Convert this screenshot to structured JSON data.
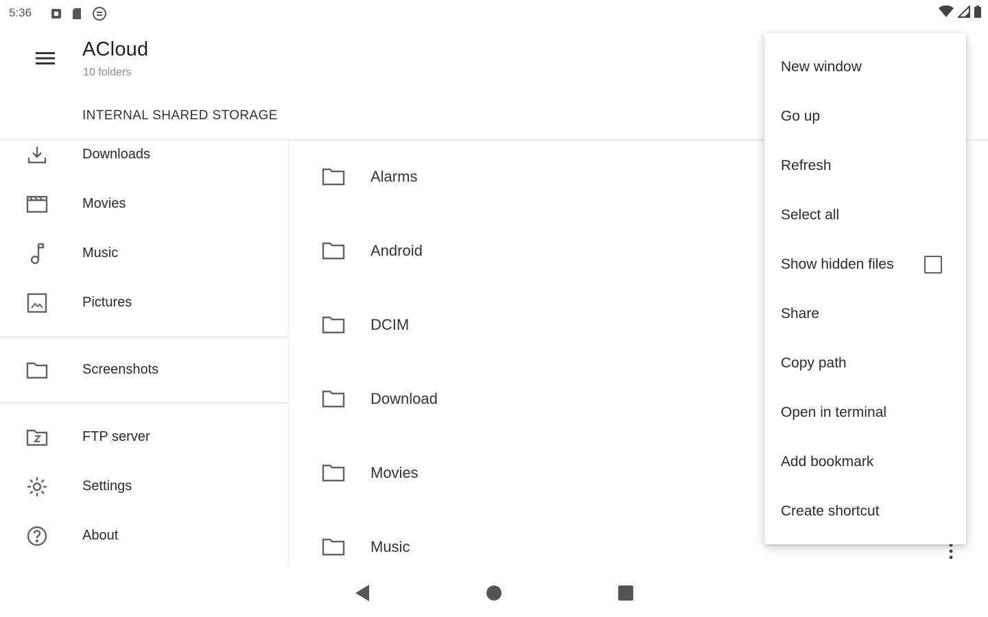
{
  "status_bar": {
    "time": "5:36",
    "left_icons": [
      "notification-square-icon",
      "sd-card-icon",
      "sync-icon"
    ],
    "right_icons": [
      "wifi-icon",
      "cell-signal-icon",
      "battery-icon"
    ]
  },
  "app_bar": {
    "menu_icon": "hamburger-menu-icon",
    "title": "ACloud",
    "subtitle": "10 folders",
    "breadcrumb": "INTERNAL SHARED STORAGE"
  },
  "drawer": {
    "items": [
      {
        "label": "Downloads",
        "icon": "download-icon"
      },
      {
        "label": "Movies",
        "icon": "movie-icon"
      },
      {
        "label": "Music",
        "icon": "music-note-icon"
      },
      {
        "label": "Pictures",
        "icon": "image-icon"
      },
      {
        "label": "Screenshots",
        "icon": "folder-icon"
      },
      {
        "label": "FTP server",
        "icon": "ftp-folder-icon"
      },
      {
        "label": "Settings",
        "icon": "gear-icon"
      },
      {
        "label": "About",
        "icon": "help-circle-icon"
      }
    ]
  },
  "files": {
    "items": [
      {
        "name": "Alarms",
        "icon": "folder-icon"
      },
      {
        "name": "Android",
        "icon": "folder-icon"
      },
      {
        "name": "DCIM",
        "icon": "folder-icon"
      },
      {
        "name": "Download",
        "icon": "folder-icon"
      },
      {
        "name": "Movies",
        "icon": "folder-icon"
      },
      {
        "name": "Music",
        "icon": "folder-icon"
      }
    ],
    "more_icon": "more-vertical-icon"
  },
  "overflow_menu": {
    "items": [
      {
        "label": "New window"
      },
      {
        "label": "Go up"
      },
      {
        "label": "Refresh"
      },
      {
        "label": "Select all"
      },
      {
        "label": "Show hidden files",
        "checkbox": true,
        "checked": false
      },
      {
        "label": "Share"
      },
      {
        "label": "Copy path"
      },
      {
        "label": "Open in terminal"
      },
      {
        "label": "Add bookmark"
      },
      {
        "label": "Create shortcut"
      }
    ]
  },
  "nav_bar": {
    "buttons": [
      "back-icon",
      "home-icon",
      "recents-icon"
    ]
  },
  "colors": {
    "icon": "#5f6368",
    "text_primary": "#202124",
    "text_secondary": "#8a8a8a",
    "divider": "#e4e4e4"
  }
}
